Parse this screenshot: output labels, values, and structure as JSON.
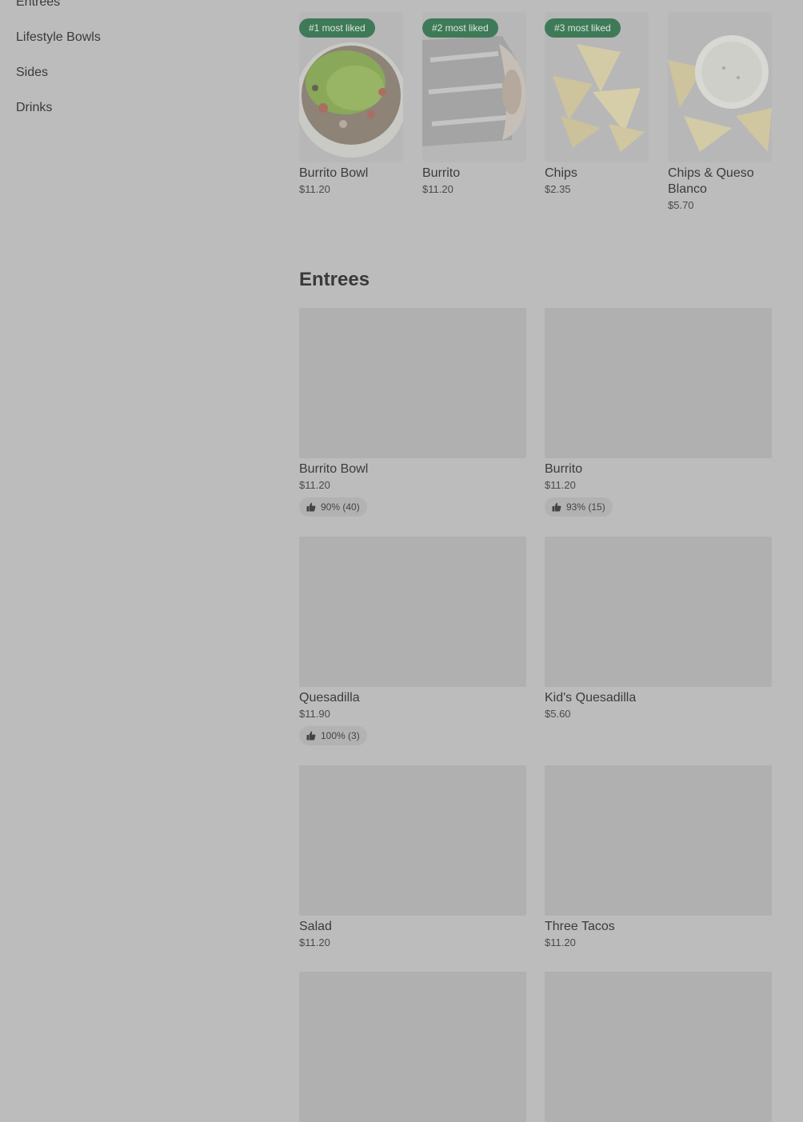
{
  "sidebar": {
    "items": [
      {
        "label": "Entrees"
      },
      {
        "label": "Lifestyle Bowls"
      },
      {
        "label": "Sides"
      },
      {
        "label": "Drinks"
      }
    ]
  },
  "popular": [
    {
      "badge": "#1 most liked",
      "name": "Burrito Bowl",
      "price": "$11.20"
    },
    {
      "badge": "#2 most liked",
      "name": "Burrito",
      "price": "$11.20"
    },
    {
      "badge": "#3 most liked",
      "name": "Chips",
      "price": "$2.35"
    },
    {
      "badge": "",
      "name": "Chips & Queso Blanco",
      "price": "$5.70"
    }
  ],
  "entrees_section": {
    "title": "Entrees",
    "items": [
      {
        "name": "Burrito Bowl",
        "price": "$11.20",
        "rating": "90% (40)"
      },
      {
        "name": "Burrito",
        "price": "$11.20",
        "rating": "93% (15)"
      },
      {
        "name": "Quesadilla",
        "price": "$11.90",
        "rating": "100% (3)"
      },
      {
        "name": "Kid's Quesadilla",
        "price": "$5.60",
        "rating": ""
      },
      {
        "name": "Salad",
        "price": "$11.20",
        "rating": ""
      },
      {
        "name": "Three Tacos",
        "price": "$11.20",
        "rating": ""
      }
    ]
  },
  "colors": {
    "overlay_bg": "#bcbcbc",
    "badge_bg": "#3f7a58",
    "badge_text": "#d9e8de"
  },
  "icons": {
    "rating": "thumbs-up-icon"
  }
}
